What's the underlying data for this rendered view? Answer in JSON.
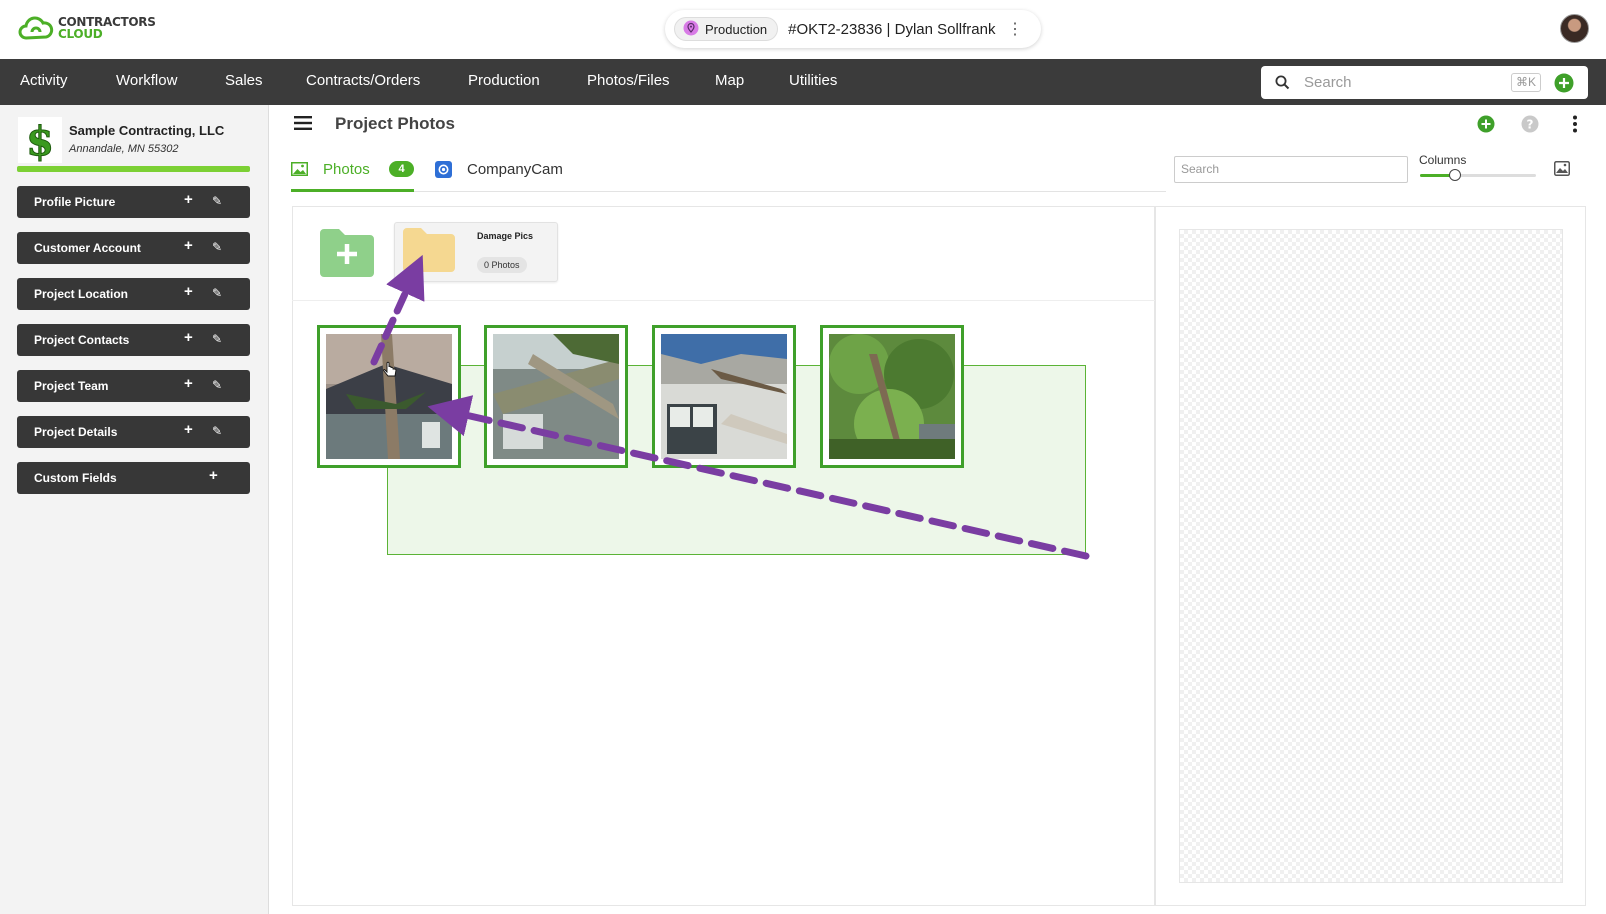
{
  "brand": {
    "line1": "CONTRACTORS",
    "line2": "CLOUD",
    "accent": "#4caf27"
  },
  "job": {
    "status": "Production",
    "title": "#OKT2-23836 | Dylan Sollfrank"
  },
  "nav": {
    "items": [
      "Activity",
      "Workflow",
      "Sales",
      "Contracts/Orders",
      "Production",
      "Photos/Files",
      "Map",
      "Utilities"
    ],
    "search_placeholder": "Search",
    "search_shortcut": "⌘K"
  },
  "sidebar": {
    "company_name": "Sample Contracting, LLC",
    "company_location": "Annandale, MN 55302",
    "sections": [
      {
        "label": "Profile Picture"
      },
      {
        "label": "Customer Account"
      },
      {
        "label": "Project Location"
      },
      {
        "label": "Project Contacts"
      },
      {
        "label": "Project Team"
      },
      {
        "label": "Project Details"
      },
      {
        "label": "Custom Fields"
      }
    ]
  },
  "main": {
    "title": "Project Photos",
    "tabs": [
      {
        "label": "Photos",
        "badge": "4",
        "active": true
      },
      {
        "label": "CompanyCam",
        "active": false
      }
    ],
    "search_placeholder": "Search",
    "columns_label": "Columns",
    "columns_level": 0.3,
    "folders": [
      {
        "name": "Damage Pics",
        "count": "0 Photos"
      }
    ],
    "photos_count": 4
  }
}
